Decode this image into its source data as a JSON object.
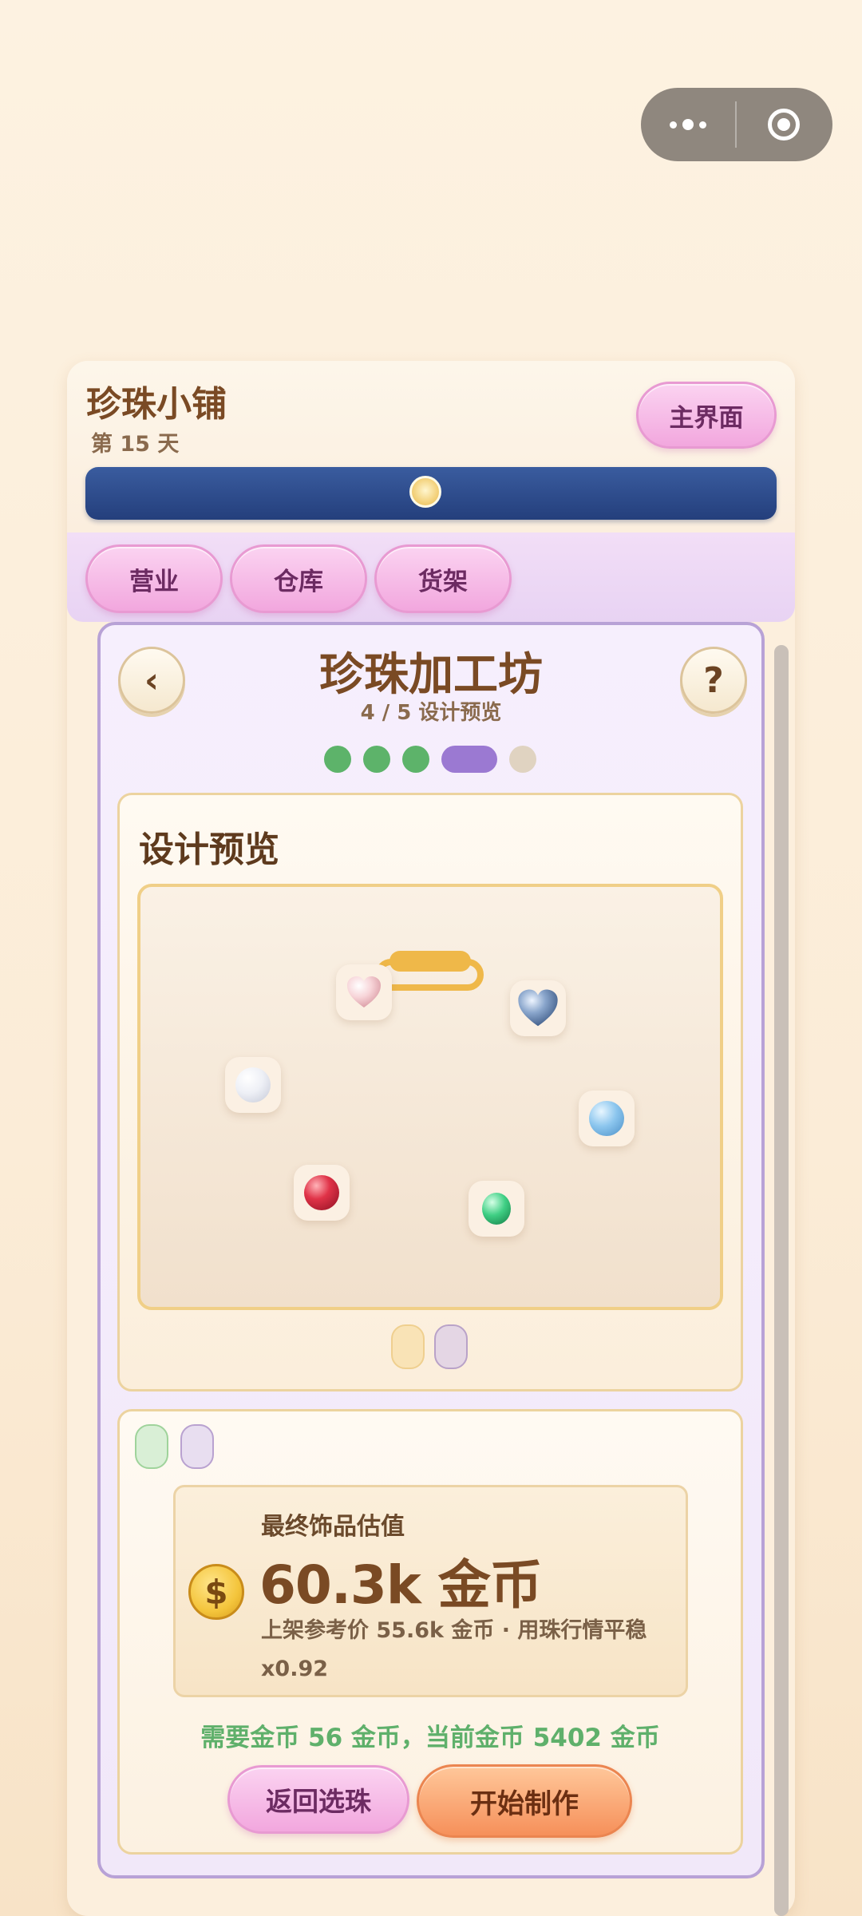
{
  "capsule": {
    "more_icon": "more-dots-icon",
    "close_icon": "target-circle-icon"
  },
  "header": {
    "title": "珍珠小铺",
    "day": "第 15 天",
    "main_button": "主界面",
    "day_progress": 0.49
  },
  "tabs": [
    {
      "label": "营业"
    },
    {
      "label": "仓库"
    },
    {
      "label": "货架"
    }
  ],
  "workshop": {
    "back_icon": "‹",
    "help_icon": "?",
    "title": "珍珠加工坊",
    "step": "4 / 5  设计预览",
    "steps_total": 5,
    "steps_current": 4
  },
  "preview": {
    "title": "设计预览",
    "beads": [
      {
        "kind": "heart-pink",
        "icon": "pink-heart-bead-icon"
      },
      {
        "kind": "heart-blue",
        "icon": "blue-heart-bead-icon"
      },
      {
        "kind": "white-pearl",
        "icon": "white-pearl-icon"
      },
      {
        "kind": "blue-pearl",
        "icon": "blue-pearl-icon"
      },
      {
        "kind": "red-pearl",
        "icon": "red-pearl-icon"
      },
      {
        "kind": "green-pearl",
        "icon": "green-pearl-icon"
      }
    ],
    "clasp_icon": "clasp-icon",
    "colors": {
      "gold": "#efb849",
      "purple": "#9b79d2",
      "green": "#5db36a"
    }
  },
  "valuation": {
    "label": "最终饰品估值",
    "amount": "60.3k 金币",
    "detail": "上架参考价 55.6k 金币 · 用珠行情平稳 x0.92",
    "coin_symbol": "$"
  },
  "cost_line": "需要金币 56 金币，当前金币 5402 金币",
  "buttons": {
    "back_select": "返回选珠",
    "start": "开始制作"
  }
}
